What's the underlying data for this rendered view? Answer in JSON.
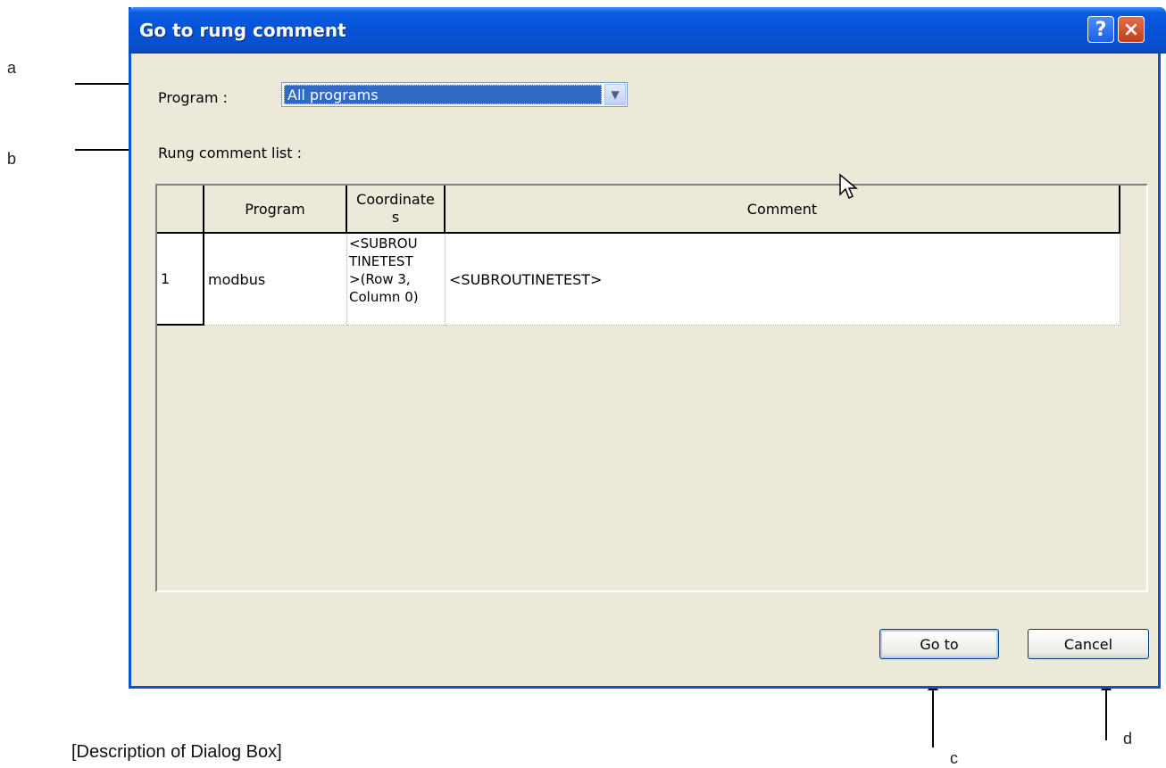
{
  "annotations": {
    "a": "a",
    "b": "b",
    "c": "c",
    "d": "d",
    "caption": "[Description of Dialog Box]"
  },
  "dialog": {
    "title": "Go to rung comment",
    "help_label": "?",
    "close_label": "×",
    "program_label": "Program :",
    "program_value": "All programs",
    "list_label": "Rung comment list :"
  },
  "table": {
    "headers": [
      "Program",
      "Coordinate\ns",
      "Comment"
    ],
    "rows": [
      {
        "num": "1",
        "program": "modbus",
        "coordinates": "<SUBROU\nTINETEST\n>(Row 3,\nColumn 0)",
        "comment": "<SUBROUTINETEST>"
      }
    ]
  },
  "buttons": {
    "goto": "Go to",
    "cancel": "Cancel"
  },
  "colors": {
    "titlebar": "#0653d6",
    "dialog_bg": "#ece9d8",
    "selection": "#316ac5"
  }
}
